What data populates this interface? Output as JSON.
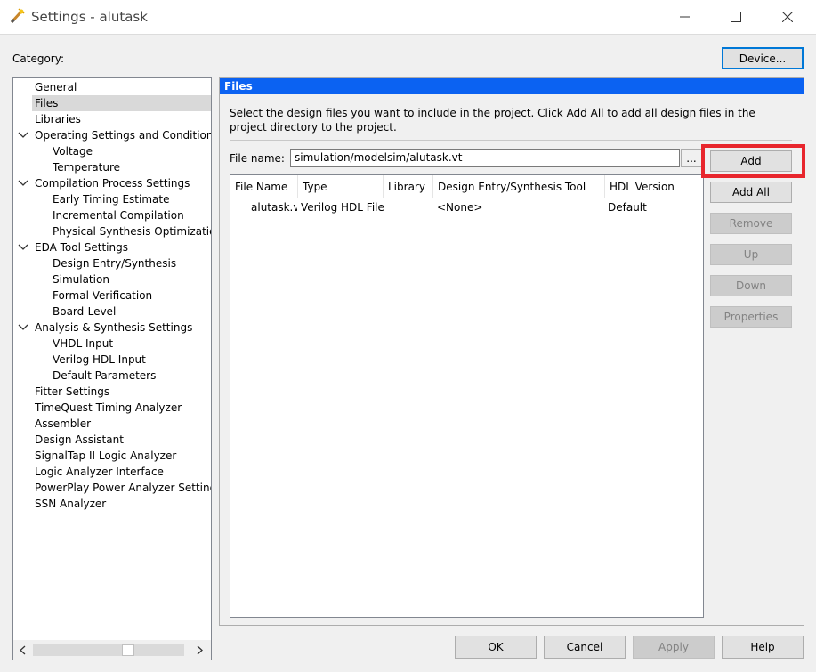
{
  "window": {
    "title": "Settings - alutask",
    "controls": {
      "minimize": "minimize-icon",
      "maximize": "maximize-icon",
      "close": "close-icon"
    }
  },
  "category_label": "Category:",
  "device_button": "Device...",
  "tree": {
    "items": [
      {
        "label": "General",
        "level": 0
      },
      {
        "label": "Files",
        "level": 0,
        "selected": true
      },
      {
        "label": "Libraries",
        "level": 0
      },
      {
        "label": "Operating Settings and Conditions",
        "level": 0,
        "expanded": true
      },
      {
        "label": "Voltage",
        "level": 1
      },
      {
        "label": "Temperature",
        "level": 1
      },
      {
        "label": "Compilation Process Settings",
        "level": 0,
        "expanded": true
      },
      {
        "label": "Early Timing Estimate",
        "level": 1
      },
      {
        "label": "Incremental Compilation",
        "level": 1
      },
      {
        "label": "Physical Synthesis Optimizations",
        "level": 1
      },
      {
        "label": "EDA Tool Settings",
        "level": 0,
        "expanded": true
      },
      {
        "label": "Design Entry/Synthesis",
        "level": 1
      },
      {
        "label": "Simulation",
        "level": 1
      },
      {
        "label": "Formal Verification",
        "level": 1
      },
      {
        "label": "Board-Level",
        "level": 1
      },
      {
        "label": "Analysis & Synthesis Settings",
        "level": 0,
        "expanded": true
      },
      {
        "label": "VHDL Input",
        "level": 1
      },
      {
        "label": "Verilog HDL Input",
        "level": 1
      },
      {
        "label": "Default Parameters",
        "level": 1
      },
      {
        "label": "Fitter Settings",
        "level": 0
      },
      {
        "label": "TimeQuest Timing Analyzer",
        "level": 0
      },
      {
        "label": "Assembler",
        "level": 0
      },
      {
        "label": "Design Assistant",
        "level": 0
      },
      {
        "label": "SignalTap II Logic Analyzer",
        "level": 0
      },
      {
        "label": "Logic Analyzer Interface",
        "level": 0
      },
      {
        "label": "PowerPlay Power Analyzer Settings",
        "level": 0
      },
      {
        "label": "SSN Analyzer",
        "level": 0
      }
    ]
  },
  "files_panel": {
    "header": "Files",
    "description": "Select the design files you want to include in the project. Click Add All to add all design files in the project directory to the project.",
    "file_name_label": "File name:",
    "file_name_value": "simulation/modelsim/alutask.vt",
    "browse_label": "...",
    "columns": [
      "File Name",
      "Type",
      "Library",
      "Design Entry/Synthesis Tool",
      "HDL Version"
    ],
    "rows": [
      {
        "file_name": "alutask.vt",
        "type": "Verilog HDL File",
        "library": "",
        "tool": "<None>",
        "hdl_version": "Default"
      }
    ],
    "buttons": {
      "add": "Add",
      "add_all": "Add All",
      "remove": "Remove",
      "up": "Up",
      "down": "Down",
      "properties": "Properties"
    }
  },
  "footer": {
    "ok": "OK",
    "cancel": "Cancel",
    "apply": "Apply",
    "help": "Help"
  },
  "colors": {
    "header_blue": "#0b62f2",
    "highlight_red": "#e8262d",
    "selection": "#d9d9d9"
  }
}
